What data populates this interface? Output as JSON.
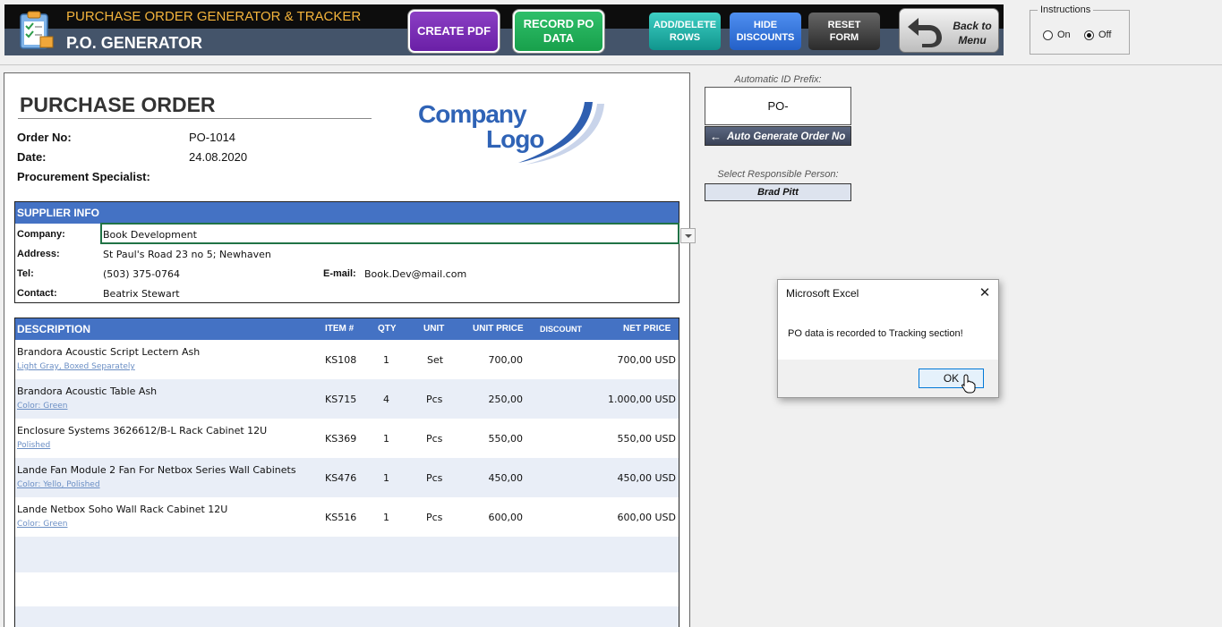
{
  "header": {
    "subtitle": "PURCHASE ORDER GENERATOR & TRACKER",
    "title": "P.O. GENERATOR",
    "buttons": {
      "create_pdf": "CREATE PDF",
      "record_po_1": "RECORD PO",
      "record_po_2": "DATA",
      "add_delete_1": "ADD/DELETE",
      "add_delete_2": "ROWS",
      "hide_discounts_1": "HIDE",
      "hide_discounts_2": "DISCOUNTS",
      "reset_form_1": "RESET",
      "reset_form_2": "FORM",
      "back_1": "Back to",
      "back_2": "Menu"
    }
  },
  "instructions": {
    "title": "Instructions",
    "on": "On",
    "off": "Off",
    "selected": "Off"
  },
  "po": {
    "heading": "PURCHASE ORDER",
    "order_no_label": "Order No:",
    "order_no": "PO-1014",
    "date_label": "Date:",
    "date": "24.08.2020",
    "specialist_label": "Procurement Specialist:",
    "logo_line1": "Company",
    "logo_line2": "Logo"
  },
  "supplier": {
    "heading": "SUPPLIER INFO",
    "company_label": "Company:",
    "company": "Book Development",
    "address_label": "Address:",
    "address": "St Paul's Road 23 no 5; Newhaven",
    "tel_label": "Tel:",
    "tel": "(503) 375-0764",
    "email_label": "E-mail:",
    "email": "Book.Dev@mail.com",
    "contact_label": "Contact:",
    "contact": "Beatrix Stewart"
  },
  "items": {
    "headers": {
      "description": "DESCRIPTION",
      "item": "ITEM #",
      "qty": "QTY",
      "unit": "UNIT",
      "unit_price": "UNIT PRICE",
      "discount": "DISCOUNT",
      "net_price": "NET PRICE"
    },
    "rows": [
      {
        "desc": "Brandora Acoustic Script Lectern Ash",
        "sub": "Light Gray, Boxed Separately",
        "item": "KS108",
        "qty": "1",
        "unit": "Set",
        "price": "700,00",
        "net": "700,00",
        "cur": "USD"
      },
      {
        "desc": "Brandora Acoustic Table Ash",
        "sub": "Color: Green",
        "item": "KS715",
        "qty": "4",
        "unit": "Pcs",
        "price": "250,00",
        "net": "1.000,00",
        "cur": "USD"
      },
      {
        "desc": "Enclosure Systems 3626612/B-L Rack Cabinet 12U",
        "sub": "Polished",
        "item": "KS369",
        "qty": "1",
        "unit": "Pcs",
        "price": "550,00",
        "net": "550,00",
        "cur": "USD"
      },
      {
        "desc": "Lande Fan Module 2 Fan For Netbox Series Wall Cabinets",
        "sub": "Color: Yello, Polished",
        "item": "KS476",
        "qty": "1",
        "unit": "Pcs",
        "price": "450,00",
        "net": "450,00",
        "cur": "USD"
      },
      {
        "desc": "Lande Netbox Soho Wall Rack Cabinet 12U",
        "sub": "Color: Green",
        "item": "KS516",
        "qty": "1",
        "unit": "Pcs",
        "price": "600,00",
        "net": "600,00",
        "cur": "USD"
      }
    ]
  },
  "side": {
    "prefix_label": "Automatic ID Prefix:",
    "prefix_value": "PO-",
    "autogen_label": "Auto Generate Order No",
    "resp_label": "Select Responsible Person:",
    "resp_value": "Brad Pitt"
  },
  "dialog": {
    "title": "Microsoft Excel",
    "message": "PO data is recorded to Tracking section!",
    "ok": "OK"
  }
}
